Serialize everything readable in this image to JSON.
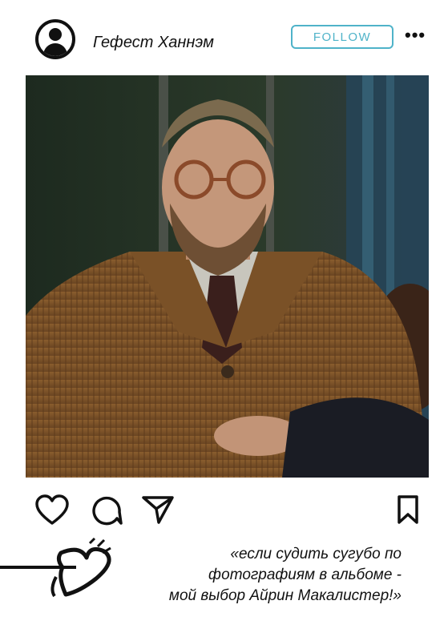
{
  "post": {
    "username": "Гефест Ханнэм",
    "follow_label": "FOLLOW",
    "more_label": "•••",
    "caption_lines": [
      "«если судить сугубо по",
      "фотографиям в альбоме -",
      "мой выбор Айрин Макалистер!»"
    ]
  },
  "icons": [
    "user-avatar-icon",
    "heart-icon",
    "comment-icon",
    "share-icon",
    "bookmark-icon",
    "hand-drawn-heart-arrow"
  ],
  "colors": {
    "accent": "#4fb3c9",
    "text": "#111111",
    "background": "#ffffff"
  }
}
